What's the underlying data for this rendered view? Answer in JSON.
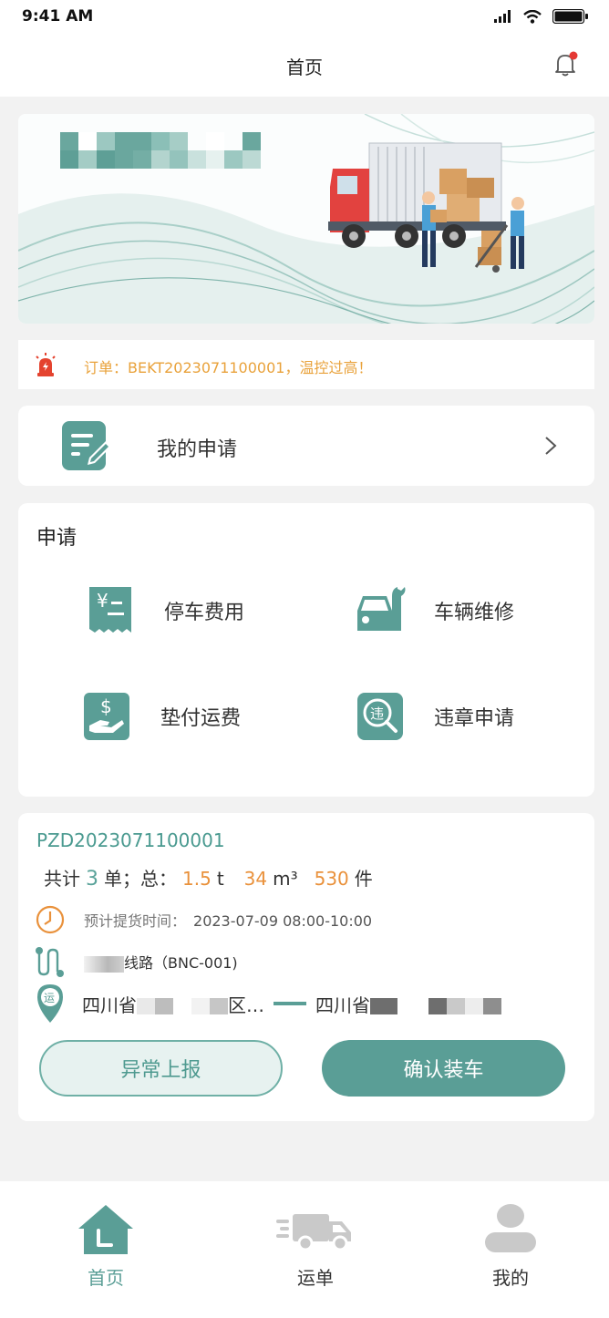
{
  "status_bar": {
    "time": "9:41 AM"
  },
  "nav": {
    "title": "首页"
  },
  "alert": {
    "text": "订单：BEKT2023071100001，温控过高！"
  },
  "my_apply": {
    "label": "我的申请"
  },
  "apply": {
    "title": "申请",
    "items": [
      {
        "label": "停车费用",
        "icon": "parking-fee-icon"
      },
      {
        "label": "车辆维修",
        "icon": "vehicle-repair-icon"
      },
      {
        "label": "垫付运费",
        "icon": "advance-freight-icon"
      },
      {
        "label": "违章申请",
        "icon": "violation-icon"
      }
    ]
  },
  "order": {
    "number": "PZD2023071100001",
    "summary": {
      "prefix": "共计",
      "count": "3",
      "count_unit": "单；总：",
      "weight": "1.5",
      "weight_unit": "t",
      "volume": "34",
      "volume_unit": "m³",
      "pieces": "530",
      "pieces_unit": "件"
    },
    "pickup_label": "预计提货时间：",
    "pickup_time": "2023-07-09   08:00-10:00",
    "route_suffix": "线路（BNC-001)",
    "origin_prefix": "四川省",
    "origin_suffix": "区…",
    "dest_prefix": "四川省",
    "exception_button": "异常上报",
    "confirm_button": "确认装车"
  },
  "tabs": [
    {
      "label": "首页",
      "active": true,
      "icon": "home-icon"
    },
    {
      "label": "运单",
      "active": false,
      "icon": "truck-icon"
    },
    {
      "label": "我的",
      "active": false,
      "icon": "user-icon"
    }
  ],
  "colors": {
    "primary": "#5a9e96",
    "accent_orange": "#e9913b",
    "alert_text": "#e9a23b"
  }
}
